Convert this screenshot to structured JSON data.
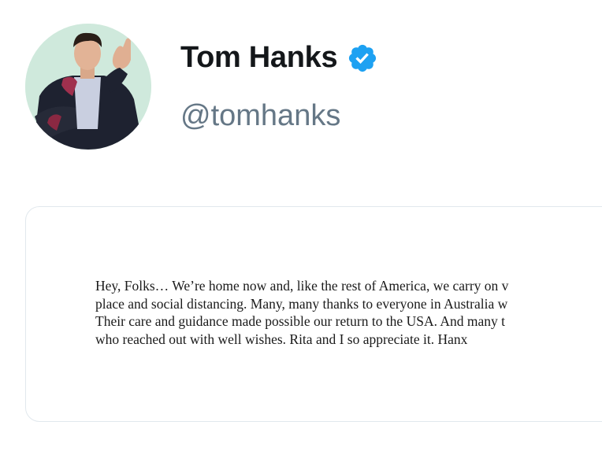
{
  "profile": {
    "display_name": "Tom Hanks",
    "handle": "@tomhanks",
    "avatar_icon": "avatar-photo",
    "verified_icon": "verified-badge-icon",
    "verified_color": "#1da1f2"
  },
  "note": {
    "lines": [
      "Hey, Folks… We’re home now and, like the rest of America, we carry on v",
      "place and social distancing. Many, many thanks to everyone in Australia w",
      "Their care and guidance made possible our return to the USA. And many t",
      "who reached out with well wishes. Rita and I so appreciate it. Hanx"
    ]
  }
}
